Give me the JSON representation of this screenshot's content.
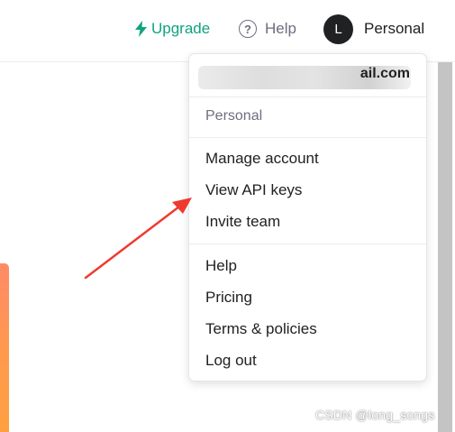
{
  "header": {
    "upgrade_label": "Upgrade",
    "help_label": "Help",
    "help_icon_glyph": "?",
    "avatar_initial": "L",
    "org_label": "Personal"
  },
  "account_menu": {
    "email_visible_tail": "ail.com",
    "org_name": "Personal",
    "group_account": [
      "Manage account",
      "View API keys",
      "Invite team"
    ],
    "group_general": [
      "Help",
      "Pricing",
      "Terms & policies",
      "Log out"
    ]
  },
  "annotation": {
    "arrow_target": "View API keys",
    "arrow_color": "#f03a2f"
  },
  "watermark": "CSDN @long_songs",
  "colors": {
    "accent_green": "#10a37f",
    "text_dark": "#202123",
    "text_muted": "#6e6e80",
    "avatar_bg": "#202123"
  }
}
